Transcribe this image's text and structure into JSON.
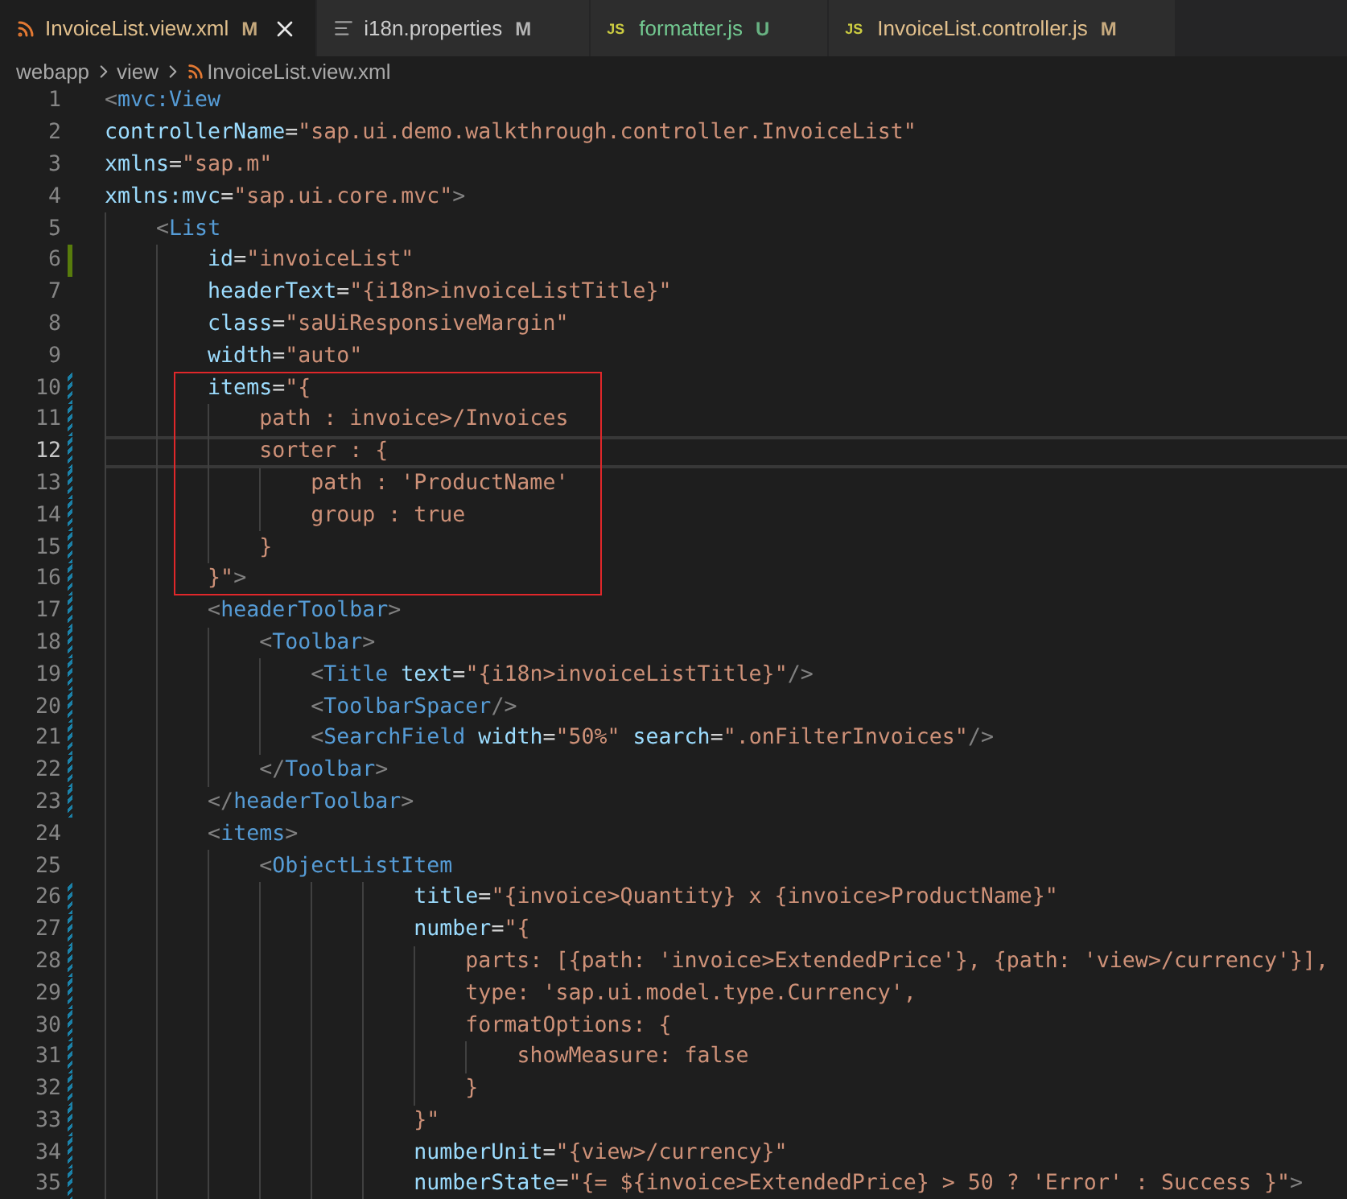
{
  "tabs": [
    {
      "label": "InvoiceList.view.xml",
      "status": "M",
      "color": "#e2c08d",
      "icon": {
        "kind": "feed"
      },
      "selected": true
    },
    {
      "label": "i18n.properties",
      "status": "M",
      "color": "#cccccc",
      "icon": {
        "kind": "lines"
      },
      "selected": false
    },
    {
      "label": "formatter.js",
      "status": "U",
      "color": "#73c991",
      "icon": {
        "kind": "badge",
        "text": "JS"
      },
      "selected": false
    },
    {
      "label": "InvoiceList.controller.js",
      "status": "M",
      "color": "#e2c08d",
      "icon": {
        "kind": "badge",
        "text": "JS"
      },
      "selected": false
    }
  ],
  "breadcrumb": [
    {
      "label": "webapp"
    },
    {
      "label": "view"
    },
    {
      "label": "InvoiceList.view.xml"
    }
  ],
  "lines": [
    {
      "n": "1",
      "tokens": [
        {
          "kind": "punct",
          "text": "<"
        },
        {
          "kind": "tag",
          "text": "mvc:View"
        }
      ],
      "current": false,
      "added": false,
      "modified": false,
      "boxed": false
    },
    {
      "n": "2",
      "tokens": [
        {
          "kind": "attr",
          "text": "controllerName"
        },
        {
          "kind": "plain",
          "text": "="
        },
        {
          "kind": "string",
          "text": "\"sap.ui.demo.walkthrough.controller.InvoiceList\""
        }
      ],
      "current": false,
      "added": false,
      "modified": false,
      "boxed": false
    },
    {
      "n": "3",
      "tokens": [
        {
          "kind": "attr",
          "text": "xmlns"
        },
        {
          "kind": "plain",
          "text": "="
        },
        {
          "kind": "string",
          "text": "\"sap.m\""
        }
      ],
      "current": false,
      "added": false,
      "modified": false,
      "boxed": false
    },
    {
      "n": "4",
      "tokens": [
        {
          "kind": "attr",
          "text": "xmlns:mvc"
        },
        {
          "kind": "plain",
          "text": "="
        },
        {
          "kind": "string",
          "text": "\"sap.ui.core.mvc\""
        },
        {
          "kind": "punct",
          "text": ">"
        }
      ],
      "current": false,
      "added": false,
      "modified": false,
      "boxed": false
    },
    {
      "n": "5",
      "tokens": [
        {
          "kind": "punct",
          "text": "    <"
        },
        {
          "kind": "tag",
          "text": "List"
        }
      ],
      "current": false,
      "added": false,
      "modified": false,
      "boxed": false
    },
    {
      "n": "6",
      "tokens": [
        {
          "kind": "attr",
          "text": "        id"
        },
        {
          "kind": "plain",
          "text": "="
        },
        {
          "kind": "string",
          "text": "\"invoiceList\""
        }
      ],
      "current": false,
      "added": true,
      "modified": false,
      "boxed": false
    },
    {
      "n": "7",
      "tokens": [
        {
          "kind": "attr",
          "text": "        headerText"
        },
        {
          "kind": "plain",
          "text": "="
        },
        {
          "kind": "string",
          "text": "\"{i18n>invoiceListTitle}\""
        }
      ],
      "current": false,
      "added": false,
      "modified": false,
      "boxed": false
    },
    {
      "n": "8",
      "tokens": [
        {
          "kind": "attr",
          "text": "        class"
        },
        {
          "kind": "plain",
          "text": "="
        },
        {
          "kind": "string",
          "text": "\"saUiResponsiveMargin\""
        }
      ],
      "current": false,
      "added": false,
      "modified": false,
      "boxed": false
    },
    {
      "n": "9",
      "tokens": [
        {
          "kind": "attr",
          "text": "        width"
        },
        {
          "kind": "plain",
          "text": "="
        },
        {
          "kind": "string",
          "text": "\"auto\""
        }
      ],
      "current": false,
      "added": false,
      "modified": false,
      "boxed": false
    },
    {
      "n": "10",
      "tokens": [
        {
          "kind": "attr",
          "text": "        items"
        },
        {
          "kind": "plain",
          "text": "="
        },
        {
          "kind": "string",
          "text": "\"{"
        }
      ],
      "current": false,
      "added": false,
      "modified": true,
      "boxed": true
    },
    {
      "n": "11",
      "tokens": [
        {
          "kind": "string",
          "text": "            path : invoice>/Invoices"
        }
      ],
      "current": false,
      "added": false,
      "modified": true,
      "boxed": true
    },
    {
      "n": "12",
      "tokens": [
        {
          "kind": "string",
          "text": "            sorter : {"
        }
      ],
      "current": true,
      "added": false,
      "modified": true,
      "boxed": true
    },
    {
      "n": "13",
      "tokens": [
        {
          "kind": "string",
          "text": "                path : 'ProductName'"
        }
      ],
      "current": false,
      "added": false,
      "modified": true,
      "boxed": true
    },
    {
      "n": "14",
      "tokens": [
        {
          "kind": "string",
          "text": "                group : true"
        }
      ],
      "current": false,
      "added": false,
      "modified": true,
      "boxed": true
    },
    {
      "n": "15",
      "tokens": [
        {
          "kind": "string",
          "text": "            }"
        }
      ],
      "current": false,
      "added": false,
      "modified": true,
      "boxed": true
    },
    {
      "n": "16",
      "tokens": [
        {
          "kind": "string",
          "text": "        }\""
        },
        {
          "kind": "punct",
          "text": ">"
        }
      ],
      "current": false,
      "added": false,
      "modified": true,
      "boxed": true
    },
    {
      "n": "17",
      "tokens": [
        {
          "kind": "punct",
          "text": "        <"
        },
        {
          "kind": "tag",
          "text": "headerToolbar"
        },
        {
          "kind": "punct",
          "text": ">"
        }
      ],
      "current": false,
      "added": false,
      "modified": true,
      "boxed": false
    },
    {
      "n": "18",
      "tokens": [
        {
          "kind": "punct",
          "text": "            <"
        },
        {
          "kind": "tag",
          "text": "Toolbar"
        },
        {
          "kind": "punct",
          "text": ">"
        }
      ],
      "current": false,
      "added": false,
      "modified": true,
      "boxed": false
    },
    {
      "n": "19",
      "tokens": [
        {
          "kind": "punct",
          "text": "                <"
        },
        {
          "kind": "tag",
          "text": "Title"
        },
        {
          "kind": "attr",
          "text": " text"
        },
        {
          "kind": "plain",
          "text": "="
        },
        {
          "kind": "string",
          "text": "\"{i18n>invoiceListTitle}\""
        },
        {
          "kind": "punct",
          "text": "/>"
        }
      ],
      "current": false,
      "added": false,
      "modified": true,
      "boxed": false
    },
    {
      "n": "20",
      "tokens": [
        {
          "kind": "punct",
          "text": "                <"
        },
        {
          "kind": "tag",
          "text": "ToolbarSpacer"
        },
        {
          "kind": "punct",
          "text": "/>"
        }
      ],
      "current": false,
      "added": false,
      "modified": true,
      "boxed": false
    },
    {
      "n": "21",
      "tokens": [
        {
          "kind": "punct",
          "text": "                <"
        },
        {
          "kind": "tag",
          "text": "SearchField"
        },
        {
          "kind": "attr",
          "text": " width"
        },
        {
          "kind": "plain",
          "text": "="
        },
        {
          "kind": "string",
          "text": "\"50%\""
        },
        {
          "kind": "attr",
          "text": " search"
        },
        {
          "kind": "plain",
          "text": "="
        },
        {
          "kind": "string",
          "text": "\".onFilterInvoices\""
        },
        {
          "kind": "punct",
          "text": "/>"
        }
      ],
      "current": false,
      "added": false,
      "modified": true,
      "boxed": false
    },
    {
      "n": "22",
      "tokens": [
        {
          "kind": "punct",
          "text": "            </"
        },
        {
          "kind": "tag",
          "text": "Toolbar"
        },
        {
          "kind": "punct",
          "text": ">"
        }
      ],
      "current": false,
      "added": false,
      "modified": true,
      "boxed": false
    },
    {
      "n": "23",
      "tokens": [
        {
          "kind": "punct",
          "text": "        </"
        },
        {
          "kind": "tag",
          "text": "headerToolbar"
        },
        {
          "kind": "punct",
          "text": ">"
        }
      ],
      "current": false,
      "added": false,
      "modified": true,
      "boxed": false
    },
    {
      "n": "24",
      "tokens": [
        {
          "kind": "punct",
          "text": "        <"
        },
        {
          "kind": "tag",
          "text": "items"
        },
        {
          "kind": "punct",
          "text": ">"
        }
      ],
      "current": false,
      "added": false,
      "modified": false,
      "boxed": false
    },
    {
      "n": "25",
      "tokens": [
        {
          "kind": "punct",
          "text": "            <"
        },
        {
          "kind": "tag",
          "text": "ObjectListItem"
        }
      ],
      "current": false,
      "added": false,
      "modified": false,
      "boxed": false
    },
    {
      "n": "26",
      "tokens": [
        {
          "kind": "attr",
          "text": "                        title"
        },
        {
          "kind": "plain",
          "text": "="
        },
        {
          "kind": "string",
          "text": "\"{invoice>Quantity} x {invoice>ProductName}\""
        }
      ],
      "current": false,
      "added": false,
      "modified": true,
      "boxed": false
    },
    {
      "n": "27",
      "tokens": [
        {
          "kind": "attr",
          "text": "                        number"
        },
        {
          "kind": "plain",
          "text": "="
        },
        {
          "kind": "string",
          "text": "\"{"
        }
      ],
      "current": false,
      "added": false,
      "modified": true,
      "boxed": false
    },
    {
      "n": "28",
      "tokens": [
        {
          "kind": "string",
          "text": "                            parts: [{path: 'invoice>ExtendedPrice'}, {path: 'view>/currency'}],"
        }
      ],
      "current": false,
      "added": false,
      "modified": true,
      "boxed": false
    },
    {
      "n": "29",
      "tokens": [
        {
          "kind": "string",
          "text": "                            type: 'sap.ui.model.type.Currency',"
        }
      ],
      "current": false,
      "added": false,
      "modified": true,
      "boxed": false
    },
    {
      "n": "30",
      "tokens": [
        {
          "kind": "string",
          "text": "                            formatOptions: {"
        }
      ],
      "current": false,
      "added": false,
      "modified": true,
      "boxed": false
    },
    {
      "n": "31",
      "tokens": [
        {
          "kind": "string",
          "text": "                                showMeasure: false"
        }
      ],
      "current": false,
      "added": false,
      "modified": true,
      "boxed": false
    },
    {
      "n": "32",
      "tokens": [
        {
          "kind": "string",
          "text": "                            }"
        }
      ],
      "current": false,
      "added": false,
      "modified": true,
      "boxed": false
    },
    {
      "n": "33",
      "tokens": [
        {
          "kind": "string",
          "text": "                        }\""
        }
      ],
      "current": false,
      "added": false,
      "modified": true,
      "boxed": false
    },
    {
      "n": "34",
      "tokens": [
        {
          "kind": "attr",
          "text": "                        numberUnit"
        },
        {
          "kind": "plain",
          "text": "="
        },
        {
          "kind": "string",
          "text": "\"{view>/currency}\""
        }
      ],
      "current": false,
      "added": false,
      "modified": true,
      "boxed": false
    },
    {
      "n": "35",
      "tokens": [
        {
          "kind": "attr",
          "text": "                        numberState"
        },
        {
          "kind": "plain",
          "text": "="
        },
        {
          "kind": "string",
          "text": "\"{= ${invoice>ExtendedPrice} > 50 ? 'Error' : Success }\""
        },
        {
          "kind": "punct",
          "text": ">"
        }
      ],
      "current": false,
      "added": false,
      "modified": true,
      "boxed": false
    }
  ]
}
